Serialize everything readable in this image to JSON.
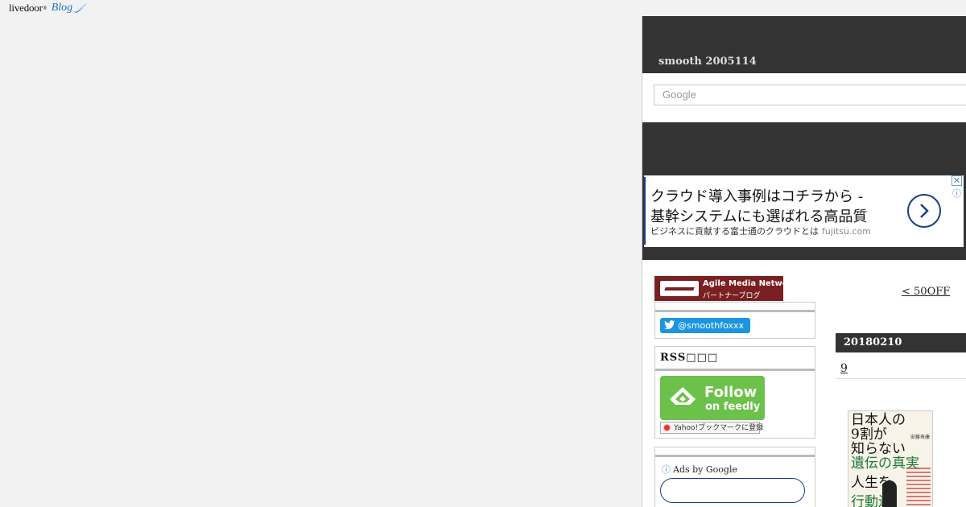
{
  "logo": {
    "brand": "livedoor",
    "tm": "®",
    "product": "Blog"
  },
  "header": {
    "blog_title": "smooth 2005114"
  },
  "search": {
    "placeholder": "Google"
  },
  "ad": {
    "line1": "クラウド導入事例はコチラから -",
    "line2": "基幹システムにも選ばれる高品質",
    "line3": "ビジネスに貢献する富士通のクラウドとは",
    "domain": "fujitsu.com",
    "close": "✕",
    "info": "ⓘ"
  },
  "sidebar": {
    "agile_line1": "Agile Media Network",
    "agile_line2": "パートナーブログ",
    "twitter_handle": "@smoothfoxxx",
    "rss_heading": "RSS□□□",
    "feedly_line1": "Follow",
    "feedly_line2": "on feedly",
    "yahoo_bookmark": "Yahoo!ブックマークに登録",
    "ads_by_google": "Ads by Google"
  },
  "main": {
    "promo_link": "< 50OFF",
    "date": "20180210",
    "entry_link": "9"
  },
  "book": {
    "title_lines": [
      "日本人の",
      "9割が",
      "知らない",
      "遺伝の真実",
      "人生を",
      "行動遺"
    ],
    "author": "安藤寿康"
  },
  "colors": {
    "header_bg": "#333333",
    "accent_blue": "#1a3e8c",
    "twitter": "#1b95e0",
    "feedly": "#6cc14a",
    "agile": "#7a1f22"
  }
}
